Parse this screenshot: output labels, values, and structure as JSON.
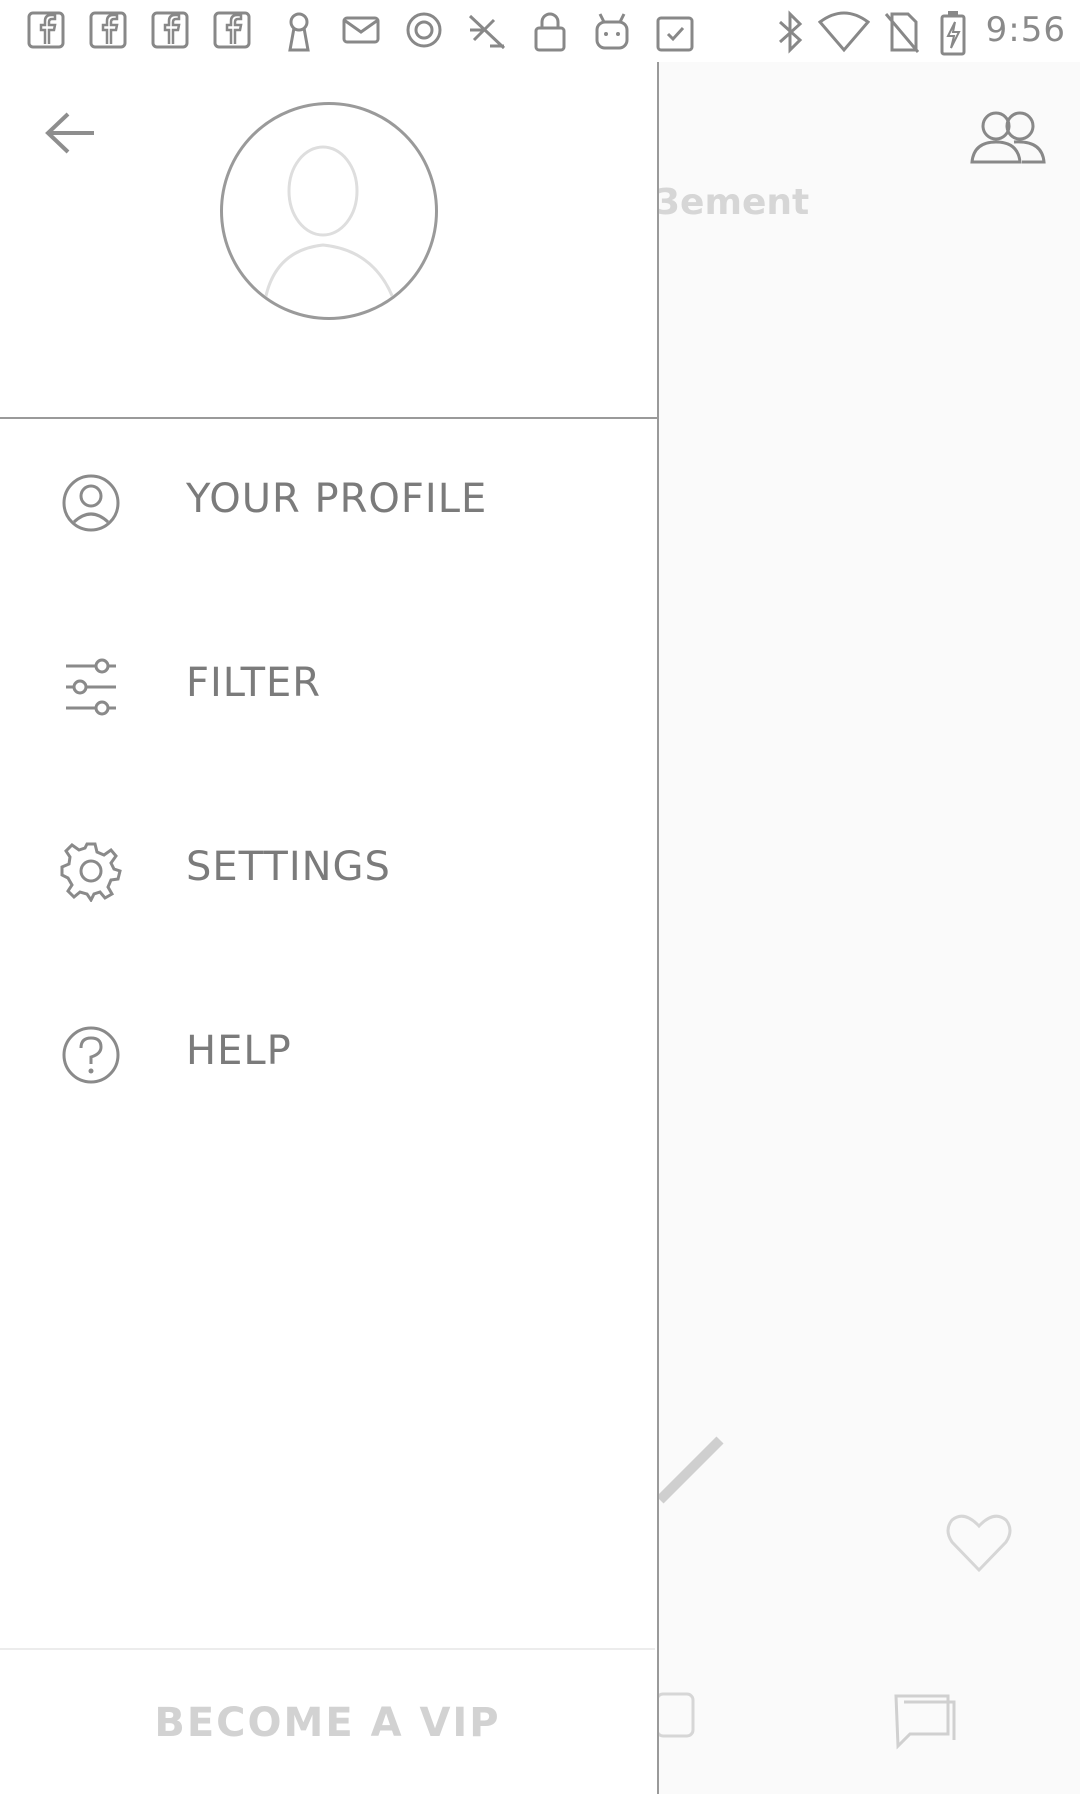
{
  "status_bar": {
    "time": "9:56",
    "notification_icons": [
      "facebook-icon",
      "facebook-icon",
      "facebook-icon",
      "facebook-icon",
      "keyhole-icon",
      "mail-icon",
      "circle-icon",
      "app-icon",
      "lock-icon",
      "android-icon",
      "clipboard-icon"
    ],
    "system_icons": [
      "bluetooth-icon",
      "wifi-icon",
      "no-sim-icon",
      "battery-charging-icon"
    ]
  },
  "background": {
    "partial_text": "3ement"
  },
  "drawer": {
    "menu": [
      {
        "label": "YOUR PROFILE",
        "icon": "user-icon"
      },
      {
        "label": "FILTER",
        "icon": "sliders-icon"
      },
      {
        "label": "SETTINGS",
        "icon": "gear-icon"
      },
      {
        "label": "HELP",
        "icon": "help-icon"
      }
    ],
    "footer_button": "BECOME A VIP"
  }
}
